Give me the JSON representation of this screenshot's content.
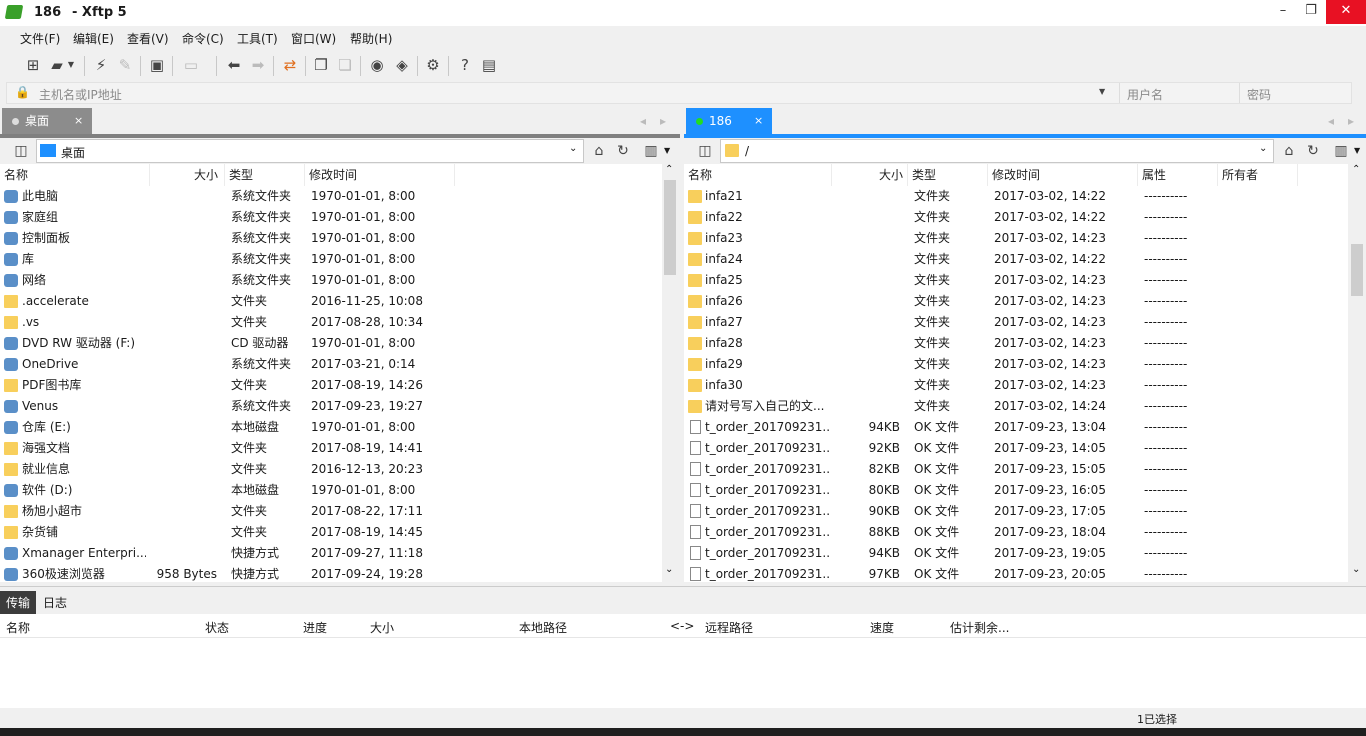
{
  "window": {
    "title_session": "186",
    "title_app": "- Xftp 5",
    "minimize": "–",
    "restore": "❐",
    "close": "✕"
  },
  "menu": [
    "文件(F)",
    "编辑(E)",
    "查看(V)",
    "命令(C)",
    "工具(T)",
    "窗口(W)",
    "帮助(H)"
  ],
  "address": {
    "host_placeholder": "主机名或IP地址",
    "user_placeholder": "用户名",
    "password_placeholder": "密码"
  },
  "left_tab": {
    "label": "桌面",
    "close": "×"
  },
  "right_tab": {
    "label": "186",
    "close": "×"
  },
  "left_path": "桌面",
  "right_path": "/",
  "left_columns": [
    "名称",
    "大小",
    "类型",
    "修改时间"
  ],
  "right_columns": [
    "名称",
    "大小",
    "类型",
    "修改时间",
    "属性",
    "所有者"
  ],
  "left_files": [
    {
      "name": "此电脑",
      "size": "",
      "type": "系统文件夹",
      "modified": "1970-01-01, 8:00",
      "icon": "pc-icon"
    },
    {
      "name": "家庭组",
      "size": "",
      "type": "系统文件夹",
      "modified": "1970-01-01, 8:00",
      "icon": "homegroup-icon"
    },
    {
      "name": "控制面板",
      "size": "",
      "type": "系统文件夹",
      "modified": "1970-01-01, 8:00",
      "icon": "control-panel-icon"
    },
    {
      "name": "库",
      "size": "",
      "type": "系统文件夹",
      "modified": "1970-01-01, 8:00",
      "icon": "library-icon"
    },
    {
      "name": "网络",
      "size": "",
      "type": "系统文件夹",
      "modified": "1970-01-01, 8:00",
      "icon": "network-icon"
    },
    {
      "name": ".accelerate",
      "size": "",
      "type": "文件夹",
      "modified": "2016-11-25, 10:08",
      "icon": "folder-icon"
    },
    {
      "name": ".vs",
      "size": "",
      "type": "文件夹",
      "modified": "2017-08-28, 10:34",
      "icon": "folder-icon"
    },
    {
      "name": "DVD RW 驱动器 (F:)",
      "size": "",
      "type": "CD 驱动器",
      "modified": "1970-01-01, 8:00",
      "icon": "dvd-icon"
    },
    {
      "name": "OneDrive",
      "size": "",
      "type": "系统文件夹",
      "modified": "2017-03-21, 0:14",
      "icon": "cloud-icon"
    },
    {
      "name": "PDF图书库",
      "size": "",
      "type": "文件夹",
      "modified": "2017-08-19, 14:26",
      "icon": "folder-icon"
    },
    {
      "name": "Venus",
      "size": "",
      "type": "系统文件夹",
      "modified": "2017-09-23, 19:27",
      "icon": "user-icon"
    },
    {
      "name": "仓库 (E:)",
      "size": "",
      "type": "本地磁盘",
      "modified": "1970-01-01, 8:00",
      "icon": "drive-icon"
    },
    {
      "name": "海强文档",
      "size": "",
      "type": "文件夹",
      "modified": "2017-08-19, 14:41",
      "icon": "folder-icon"
    },
    {
      "name": "就业信息",
      "size": "",
      "type": "文件夹",
      "modified": "2016-12-13, 20:23",
      "icon": "folder-icon"
    },
    {
      "name": "软件 (D:)",
      "size": "",
      "type": "本地磁盘",
      "modified": "1970-01-01, 8:00",
      "icon": "drive-icon"
    },
    {
      "name": "杨旭小超市",
      "size": "",
      "type": "文件夹",
      "modified": "2017-08-22, 17:11",
      "icon": "folder-icon"
    },
    {
      "name": "杂货铺",
      "size": "",
      "type": "文件夹",
      "modified": "2017-08-19, 14:45",
      "icon": "folder-icon"
    },
    {
      "name": "Xmanager Enterpri...",
      "size": "",
      "type": "快捷方式",
      "modified": "2017-09-27, 11:18",
      "icon": "shortcut-icon"
    },
    {
      "name": "360极速浏览器",
      "size": "958 Bytes",
      "type": "快捷方式",
      "modified": "2017-09-24, 19:28",
      "icon": "browser-icon"
    }
  ],
  "right_files": [
    {
      "name": "infa21",
      "size": "",
      "type": "文件夹",
      "modified": "2017-03-02, 14:22",
      "attr": "----------",
      "owner": "",
      "icon": "folder-icon"
    },
    {
      "name": "infa22",
      "size": "",
      "type": "文件夹",
      "modified": "2017-03-02, 14:22",
      "attr": "----------",
      "owner": "",
      "icon": "folder-icon"
    },
    {
      "name": "infa23",
      "size": "",
      "type": "文件夹",
      "modified": "2017-03-02, 14:23",
      "attr": "----------",
      "owner": "",
      "icon": "folder-icon"
    },
    {
      "name": "infa24",
      "size": "",
      "type": "文件夹",
      "modified": "2017-03-02, 14:22",
      "attr": "----------",
      "owner": "",
      "icon": "folder-icon"
    },
    {
      "name": "infa25",
      "size": "",
      "type": "文件夹",
      "modified": "2017-03-02, 14:23",
      "attr": "----------",
      "owner": "",
      "icon": "folder-icon"
    },
    {
      "name": "infa26",
      "size": "",
      "type": "文件夹",
      "modified": "2017-03-02, 14:23",
      "attr": "----------",
      "owner": "",
      "icon": "folder-icon"
    },
    {
      "name": "infa27",
      "size": "",
      "type": "文件夹",
      "modified": "2017-03-02, 14:23",
      "attr": "----------",
      "owner": "",
      "icon": "folder-icon"
    },
    {
      "name": "infa28",
      "size": "",
      "type": "文件夹",
      "modified": "2017-03-02, 14:23",
      "attr": "----------",
      "owner": "",
      "icon": "folder-icon"
    },
    {
      "name": "infa29",
      "size": "",
      "type": "文件夹",
      "modified": "2017-03-02, 14:23",
      "attr": "----------",
      "owner": "",
      "icon": "folder-icon"
    },
    {
      "name": "infa30",
      "size": "",
      "type": "文件夹",
      "modified": "2017-03-02, 14:23",
      "attr": "----------",
      "owner": "",
      "icon": "folder-icon"
    },
    {
      "name": "请对号写入自己的文...",
      "size": "",
      "type": "文件夹",
      "modified": "2017-03-02, 14:24",
      "attr": "----------",
      "owner": "",
      "icon": "folder-icon"
    },
    {
      "name": "t_order_201709231...",
      "size": "94KB",
      "type": "OK 文件",
      "modified": "2017-09-23, 13:04",
      "attr": "----------",
      "owner": "",
      "icon": "file-icon"
    },
    {
      "name": "t_order_201709231...",
      "size": "92KB",
      "type": "OK 文件",
      "modified": "2017-09-23, 14:05",
      "attr": "----------",
      "owner": "",
      "icon": "file-icon"
    },
    {
      "name": "t_order_201709231...",
      "size": "82KB",
      "type": "OK 文件",
      "modified": "2017-09-23, 15:05",
      "attr": "----------",
      "owner": "",
      "icon": "file-icon"
    },
    {
      "name": "t_order_201709231...",
      "size": "80KB",
      "type": "OK 文件",
      "modified": "2017-09-23, 16:05",
      "attr": "----------",
      "owner": "",
      "icon": "file-icon"
    },
    {
      "name": "t_order_201709231...",
      "size": "90KB",
      "type": "OK 文件",
      "modified": "2017-09-23, 17:05",
      "attr": "----------",
      "owner": "",
      "icon": "file-icon"
    },
    {
      "name": "t_order_201709231...",
      "size": "88KB",
      "type": "OK 文件",
      "modified": "2017-09-23, 18:04",
      "attr": "----------",
      "owner": "",
      "icon": "file-icon"
    },
    {
      "name": "t_order_201709231...",
      "size": "94KB",
      "type": "OK 文件",
      "modified": "2017-09-23, 19:05",
      "attr": "----------",
      "owner": "",
      "icon": "file-icon"
    },
    {
      "name": "t_order_201709231...",
      "size": "97KB",
      "type": "OK 文件",
      "modified": "2017-09-23, 20:05",
      "attr": "----------",
      "owner": "",
      "icon": "file-icon"
    }
  ],
  "bottom_tabs": [
    "传输",
    "日志"
  ],
  "transfer_columns": [
    "名称",
    "状态",
    "进度",
    "大小",
    "本地路径",
    "<->",
    "远程路径",
    "速度",
    "估计剩余..."
  ],
  "status": {
    "selected": "1已选择"
  },
  "colors": {
    "left_tab": "#8c8c8c",
    "right_tab": "#1e90ff",
    "folder": "#f8cf5c",
    "close": "#e81123"
  }
}
